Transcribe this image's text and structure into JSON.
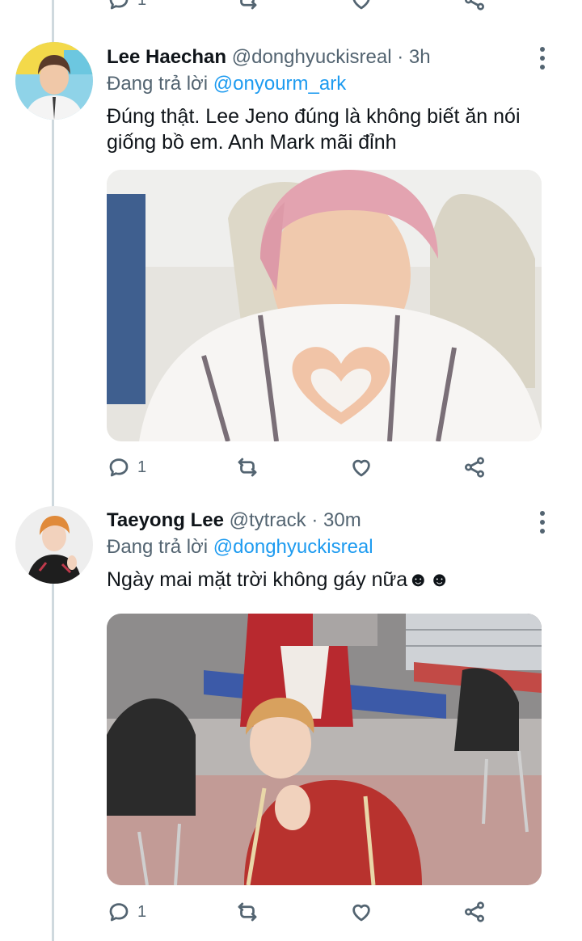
{
  "top_actions": {
    "reply_count": "1"
  },
  "tweets": [
    {
      "name": "Lee Haechan",
      "handle": "@donghyuckisreal",
      "time": "3h",
      "reply_prefix": "Đang trả lời",
      "reply_to": "@onyourm_ark",
      "text": "Đúng thật. Lee Jeno đúng là không biết ăn nói giống bồ em. Anh Mark mãi đỉnh",
      "reply_count": "1"
    },
    {
      "name": "Taeyong Lee",
      "handle": "@tytrack",
      "time": "30m",
      "reply_prefix": "Đang trả lời",
      "reply_to": "@donghyuckisreal",
      "text": "Ngày mai mặt trời không gáy nữa☻☻",
      "reply_count": "1"
    }
  ],
  "icons": {
    "reply": "reply-icon",
    "retweet": "retweet-icon",
    "like": "like-icon",
    "share": "share-icon",
    "more": "more-icon"
  },
  "colors": {
    "link": "#1d9bf0",
    "muted": "#536471",
    "thread_line": "#cfd9de"
  }
}
